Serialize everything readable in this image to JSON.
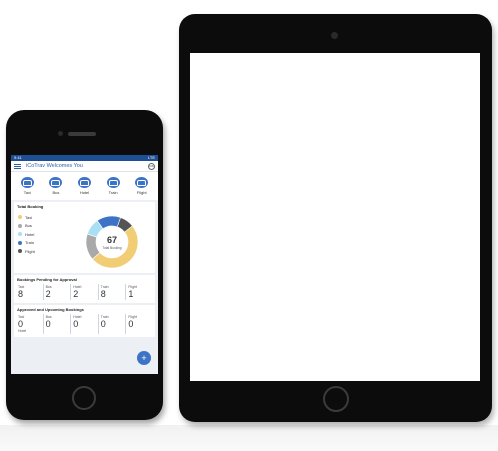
{
  "status_bar": {
    "time": "9:41",
    "right": "LTE"
  },
  "app": {
    "title": "iCoTrav Welcomes You",
    "avatar_label": "DS"
  },
  "modes": [
    {
      "label": "Taxi",
      "icon": "taxi-icon"
    },
    {
      "label": "Bus",
      "icon": "bus-icon"
    },
    {
      "label": "Hotel",
      "icon": "hotel-icon"
    },
    {
      "label": "Train",
      "icon": "train-icon"
    },
    {
      "label": "Flight",
      "icon": "flight-icon"
    }
  ],
  "total_booking": {
    "title": "Total Booking",
    "total": "67",
    "total_label": "Total Booking",
    "legend": [
      {
        "label": "Taxi",
        "color": "#f1cd76"
      },
      {
        "label": "Bus",
        "color": "#a9a9a9"
      },
      {
        "label": "Hotel",
        "color": "#a9dff4"
      },
      {
        "label": "Train",
        "color": "#3c73c7"
      },
      {
        "label": "Flight",
        "color": "#555555"
      }
    ]
  },
  "chart_data": {
    "type": "pie",
    "title": "Total Booking",
    "categories": [
      "Taxi",
      "Bus",
      "Hotel",
      "Train",
      "Flight"
    ],
    "values": [
      33,
      11,
      7,
      10,
      6
    ],
    "colors": [
      "#f1cd76",
      "#a9a9a9",
      "#a9dff4",
      "#3c73c7",
      "#555555"
    ],
    "center_value": 67,
    "legend_position": "left"
  },
  "pending": {
    "title": "Bookings Pending for Approval",
    "items": [
      {
        "label": "Taxi",
        "value": "8"
      },
      {
        "label": "Bus",
        "value": "2"
      },
      {
        "label": "Hotel",
        "value": "2"
      },
      {
        "label": "Train",
        "value": "8"
      },
      {
        "label": "Flight",
        "value": "1"
      }
    ]
  },
  "approved": {
    "title": "Approved and Upcoming Bookings",
    "items": [
      {
        "label": "Taxi",
        "value": "0"
      },
      {
        "label": "Bus",
        "value": "0"
      },
      {
        "label": "Hotel",
        "value": "0"
      },
      {
        "label": "Train",
        "value": "0"
      },
      {
        "label": "Flight",
        "value": "0"
      }
    ],
    "extra_label": "Hotel"
  },
  "fab_label": "+"
}
